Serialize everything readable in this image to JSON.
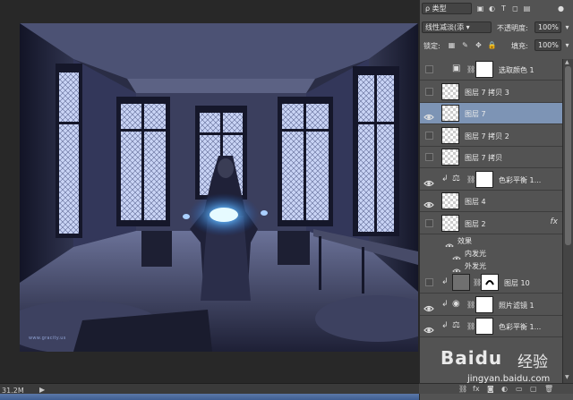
{
  "status": {
    "doc_size": "31.2M",
    "arrow": "▶"
  },
  "artwork": {
    "watermark": "www.gracity.us"
  },
  "panel": {
    "filter_kind": "ρ 类型",
    "blend_mode": "线性减淡(添",
    "opacity_label": "不透明度:",
    "opacity_value": "100%",
    "lock_label": "锁定:",
    "fill_label": "填充:",
    "fill_value": "100%"
  },
  "layers": [
    {
      "name": "选取颜色 1",
      "visible": false,
      "thumb": "white",
      "adjust": true
    },
    {
      "name": "图层 7 拷贝 3",
      "visible": false,
      "thumb": "checker"
    },
    {
      "name": "图层 7",
      "visible": true,
      "thumb": "checker",
      "selected": true
    },
    {
      "name": "图层 7 拷贝 2",
      "visible": false,
      "thumb": "checker"
    },
    {
      "name": "图层 7 拷贝",
      "visible": false,
      "thumb": "checker"
    },
    {
      "name": "色彩平衡 1...",
      "visible": true,
      "thumb": "white",
      "adjust": true,
      "clip": true
    },
    {
      "name": "图层 4",
      "visible": true,
      "thumb": "checker"
    },
    {
      "name": "图层 2",
      "visible": false,
      "thumb": "checker",
      "fx": "fx"
    },
    {
      "name": "图层 10",
      "visible": false,
      "thumb": "gray",
      "clip": true
    },
    {
      "name": "照片滤镜 1",
      "visible": true,
      "thumb": "white",
      "adjust": true,
      "clip": true
    },
    {
      "name": "色彩平衡 1...",
      "visible": true,
      "thumb": "white",
      "adjust": true,
      "clip": true
    }
  ],
  "effects": {
    "title": "效果",
    "inner_glow": "内发光",
    "outer_glow": "外发光"
  },
  "bottom_icons": [
    "link-icon",
    "fx-icon",
    "mask-icon",
    "adjust-icon",
    "folder-icon",
    "new-layer-icon",
    "trash-icon"
  ],
  "watermark": {
    "brand": "Baidu",
    "brand_cn": "经验",
    "url": "jingyan.baidu.com"
  }
}
